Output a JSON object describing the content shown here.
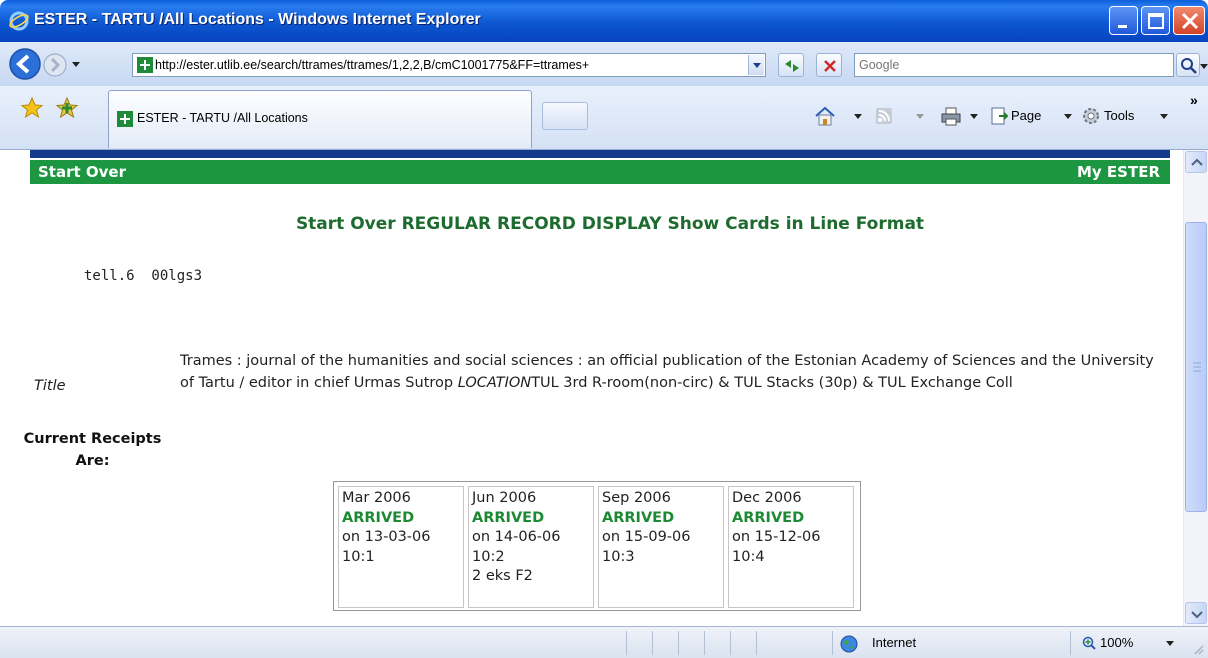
{
  "window": {
    "title": "ESTER - TARTU /All Locations - Windows Internet Explorer"
  },
  "toolbar": {
    "address": "http://ester.utlib.ee/search/ttrames/ttrames/1,2,2,B/cmC1001775&FF=ttrames+",
    "search_placeholder": "Google"
  },
  "tabs": {
    "active_label": "ESTER - TARTU /All Locations"
  },
  "command_bar": {
    "page_label": "Page",
    "tools_label": "Tools"
  },
  "page": {
    "nav": {
      "start_over": "Start Over",
      "my_ester": "My ESTER"
    },
    "heading": "Start Over REGULAR RECORD DISPLAY Show Cards in Line Format",
    "marc_line": "tell.6  00lgs3",
    "title_label": "Title",
    "title_text": "Trames : journal of the humanities and social sciences : an official publication of the Estonian Academy of Sciences and the University of Tartu / editor in chief Urmas Sutrop ",
    "location_label": "LOCATION",
    "location_text": "TUL 3rd R-room(non-circ) & TUL Stacks (30p) & TUL Exchange Coll",
    "receipts_label": "Current Receipts Are:",
    "receipts": [
      {
        "date": "Mar 2006",
        "status": "ARRIVED",
        "arrived_on": "on 13-03-06",
        "issue": "10:1",
        "note": ""
      },
      {
        "date": "Jun 2006",
        "status": "ARRIVED",
        "arrived_on": "on 14-06-06",
        "issue": "10:2",
        "note": "2 eks F2"
      },
      {
        "date": "Sep 2006",
        "status": "ARRIVED",
        "arrived_on": "on 15-09-06",
        "issue": "10:3",
        "note": ""
      },
      {
        "date": "Dec 2006",
        "status": "ARRIVED",
        "arrived_on": "on 15-12-06",
        "issue": "10:4",
        "note": ""
      }
    ],
    "colors": {
      "nav_bar": "#1d9641",
      "heading": "#1d6b2e",
      "arrived": "#1d8a33"
    }
  },
  "statusbar": {
    "zone": "Internet",
    "zoom": "100%"
  }
}
